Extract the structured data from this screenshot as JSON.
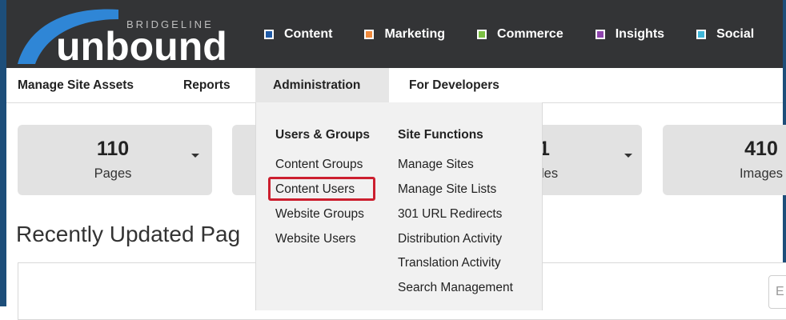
{
  "logo": {
    "brand_small": "BRIDGELINE",
    "brand": "unbound"
  },
  "top_nav": [
    {
      "label": "Content",
      "color": "#1f5aa6"
    },
    {
      "label": "Marketing",
      "color": "#f08a3c"
    },
    {
      "label": "Commerce",
      "color": "#7bc043"
    },
    {
      "label": "Insights",
      "color": "#8e44ad"
    },
    {
      "label": "Social",
      "color": "#3fb6d8"
    }
  ],
  "sub_nav": [
    {
      "label": "Manage Site Assets"
    },
    {
      "label": "Reports"
    },
    {
      "label": "Administration",
      "active": true
    },
    {
      "label": "For Developers"
    }
  ],
  "stats": [
    {
      "value": "110",
      "label": "Pages"
    },
    {
      "value": "",
      "label": ""
    },
    {
      "value": "1",
      "label": "les"
    },
    {
      "value": "410",
      "label": "Images"
    }
  ],
  "recent_heading": "Recently Updated Pag",
  "search_placeholder": "E",
  "dropdown": {
    "users_groups": {
      "heading": "Users & Groups",
      "items": [
        "Content Groups",
        "Content Users",
        "Website Groups",
        "Website Users"
      ]
    },
    "site_functions": {
      "heading": "Site Functions",
      "items": [
        "Manage Sites",
        "Manage Site Lists",
        "301 URL Redirects",
        "Distribution Activity",
        "Translation Activity",
        "Search Management"
      ]
    },
    "highlighted_item": "Content Users",
    "highlight_color": "#cc1f2f"
  }
}
